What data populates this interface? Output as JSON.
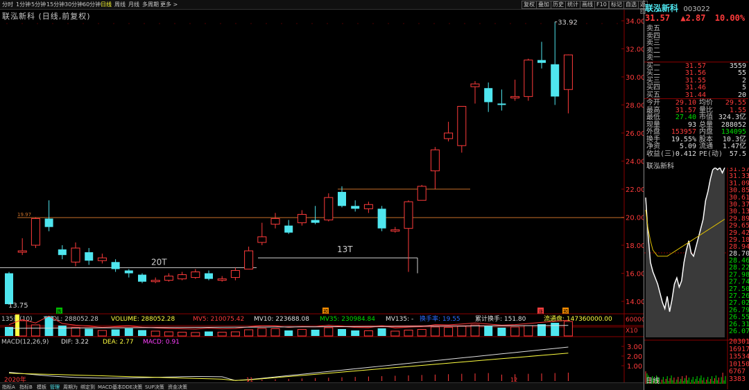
{
  "toolbar": {
    "timeframes": [
      "分时",
      "1分钟",
      "5分钟",
      "15分钟",
      "30分钟",
      "60分钟",
      "日线",
      "周线",
      "月线",
      "多周期",
      "更多 >"
    ],
    "active_timeframe": "日线",
    "right_buttons": [
      "复权",
      "叠加",
      "历史",
      "统计",
      "画线",
      "F10",
      "标记",
      "自选",
      "返回"
    ]
  },
  "chart": {
    "title": "联泓新科 (日线,前复权)",
    "price_ticks": [
      "34.00",
      "32.00",
      "30.00",
      "28.00",
      "26.00",
      "24.00",
      "22.00",
      "20.00",
      "18.00",
      "16.00",
      "14.00"
    ],
    "high_label": "33.92",
    "low_label": "13.75",
    "level_label": "19.97",
    "annotation_20t": "20T",
    "annotation_13t": "13T",
    "markers": [
      "跌",
      "预",
      "涨",
      "预"
    ],
    "volume_header": {
      "name": "135量(10)",
      "vvol": "VVOL: 288052.28",
      "volume": "VOLUME: 288052.28",
      "mv5": "MV5: 210075.42",
      "mv10": "MV10: 223688.08",
      "mv35": "MV35: 230984.84",
      "mv135": "MV135: -",
      "turnover": "换手率: 19.55",
      "cum_turnover": "累计换手: 151.80",
      "float": "流通盘: 147360000.00"
    },
    "volume_ticks": [
      "60000",
      "X10"
    ],
    "macd_header": {
      "name": "MACD(12,26,9)",
      "dif": "DIF: 3.22",
      "dea": "DEA: 2.77",
      "macd": "MACD: 0.91"
    },
    "macd_ticks": [
      "3.00",
      "2.00",
      "1.00"
    ],
    "year_label": "2020年",
    "month_labels": [
      "11",
      "12"
    ]
  },
  "candles": [
    {
      "o": 16.0,
      "c": 13.8,
      "h": 16.1,
      "l": 13.75
    },
    {
      "o": 17.5,
      "c": 17.6,
      "h": 18.5,
      "l": 17.3
    },
    {
      "o": 18.0,
      "c": 19.9,
      "h": 20.0,
      "l": 17.8
    },
    {
      "o": 19.9,
      "c": 19.3,
      "h": 21.2,
      "l": 19.0
    },
    {
      "o": 17.7,
      "c": 17.3,
      "h": 18.0,
      "l": 17.0
    },
    {
      "o": 16.8,
      "c": 17.8,
      "h": 18.2,
      "l": 16.5
    },
    {
      "o": 17.5,
      "c": 16.9,
      "h": 17.8,
      "l": 16.6
    },
    {
      "o": 16.9,
      "c": 17.1,
      "h": 17.4,
      "l": 16.7
    },
    {
      "o": 16.8,
      "c": 16.3,
      "h": 17.0,
      "l": 16.1
    },
    {
      "o": 16.2,
      "c": 16.0,
      "h": 16.3,
      "l": 15.7
    },
    {
      "o": 15.9,
      "c": 15.4,
      "h": 16.0,
      "l": 15.3
    },
    {
      "o": 15.4,
      "c": 15.5,
      "h": 15.7,
      "l": 15.3
    },
    {
      "o": 15.5,
      "c": 15.8,
      "h": 16.0,
      "l": 15.4
    },
    {
      "o": 15.6,
      "c": 15.9,
      "h": 16.1,
      "l": 15.5
    },
    {
      "o": 15.7,
      "c": 16.1,
      "h": 16.3,
      "l": 15.6
    },
    {
      "o": 16.0,
      "c": 15.6,
      "h": 16.2,
      "l": 15.5
    },
    {
      "o": 15.5,
      "c": 15.6,
      "h": 15.8,
      "l": 15.4
    },
    {
      "o": 15.7,
      "c": 16.2,
      "h": 16.4,
      "l": 15.5
    },
    {
      "o": 16.3,
      "c": 17.6,
      "h": 17.9,
      "l": 16.3
    },
    {
      "o": 18.2,
      "c": 18.6,
      "h": 19.6,
      "l": 18.0
    },
    {
      "o": 19.5,
      "c": 19.9,
      "h": 20.3,
      "l": 19.2
    },
    {
      "o": 19.4,
      "c": 18.9,
      "h": 19.8,
      "l": 18.8
    },
    {
      "o": 19.6,
      "c": 20.2,
      "h": 20.5,
      "l": 19.4
    },
    {
      "o": 19.8,
      "c": 19.6,
      "h": 20.8,
      "l": 19.5
    },
    {
      "o": 19.8,
      "c": 21.4,
      "h": 21.7,
      "l": 19.7
    },
    {
      "o": 21.8,
      "c": 20.8,
      "h": 22.2,
      "l": 20.7
    },
    {
      "o": 20.8,
      "c": 20.6,
      "h": 21.2,
      "l": 20.4
    },
    {
      "o": 20.6,
      "c": 20.9,
      "h": 21.1,
      "l": 20.3
    },
    {
      "o": 20.6,
      "c": 19.2,
      "h": 20.8,
      "l": 19.0
    },
    {
      "o": 19.0,
      "c": 19.1,
      "h": 19.3,
      "l": 18.9
    },
    {
      "o": 19.2,
      "c": 21.1,
      "h": 21.2,
      "l": 16.1
    },
    {
      "o": 21.2,
      "c": 22.2,
      "h": 22.3,
      "l": 21.2
    },
    {
      "o": 23.3,
      "c": 24.8,
      "h": 25.0,
      "l": 22.0
    },
    {
      "o": 25.6,
      "c": 26.0,
      "h": 26.8,
      "l": 25.4
    },
    {
      "o": 25.1,
      "c": 27.9,
      "h": 27.9,
      "l": 24.6
    },
    {
      "o": 29.3,
      "c": 29.5,
      "h": 29.7,
      "l": 28.1
    },
    {
      "o": 29.2,
      "c": 28.2,
      "h": 29.6,
      "l": 27.5
    },
    {
      "o": 28.1,
      "c": 28.0,
      "h": 29.1,
      "l": 27.6
    },
    {
      "o": 28.5,
      "c": 28.6,
      "h": 29.8,
      "l": 28.3
    },
    {
      "o": 28.6,
      "c": 31.2,
      "h": 31.3,
      "l": 28.3
    },
    {
      "o": 31.2,
      "c": 31.0,
      "h": 32.5,
      "l": 30.6
    },
    {
      "o": 30.9,
      "c": 28.6,
      "h": 33.92,
      "l": 28.0
    },
    {
      "o": 29.1,
      "c": 31.57,
      "h": 31.6,
      "l": 27.4
    }
  ],
  "volumes": [
    130,
    220,
    160,
    285,
    150,
    120,
    105,
    80,
    95,
    110,
    85,
    70,
    60,
    55,
    50,
    65,
    55,
    60,
    90,
    110,
    105,
    80,
    95,
    90,
    120,
    100,
    80,
    75,
    110,
    70,
    85,
    95,
    130,
    125,
    140,
    160,
    140,
    120,
    130,
    150,
    170,
    190,
    210
  ],
  "right_panel": {
    "stock_name": "联泓新科",
    "stock_code": "003022",
    "price": "31.57",
    "change": "▲2.87",
    "change_pct": "10.00%",
    "asks": [
      {
        "label": "卖五",
        "price": "",
        "vol": ""
      },
      {
        "label": "卖四",
        "price": "",
        "vol": ""
      },
      {
        "label": "卖三",
        "price": "",
        "vol": ""
      },
      {
        "label": "卖二",
        "price": "",
        "vol": ""
      },
      {
        "label": "卖一",
        "price": "",
        "vol": ""
      }
    ],
    "bids": [
      {
        "label": "买一",
        "price": "31.57",
        "vol": "3559"
      },
      {
        "label": "买二",
        "price": "31.56",
        "vol": "55"
      },
      {
        "label": "买三",
        "price": "31.55",
        "vol": "2"
      },
      {
        "label": "买四",
        "price": "31.46",
        "vol": "5"
      },
      {
        "label": "买五",
        "price": "31.44",
        "vol": "20"
      }
    ],
    "stats": [
      {
        "k1": "今开",
        "v1": "29.10",
        "k2": "均价",
        "v2": "29.55",
        "c1": "red",
        "c2": "red"
      },
      {
        "k1": "最高",
        "v1": "31.57",
        "k2": "量比",
        "v2": "1.55",
        "c1": "red",
        "c2": "red"
      },
      {
        "k1": "最低",
        "v1": "27.40",
        "k2": "市值",
        "v2": "324.3亿",
        "c1": "green",
        "c2": "white"
      },
      {
        "k1": "现量",
        "v1": "93",
        "k2": "总量",
        "v2": "288052",
        "c1": "white",
        "c2": "white"
      },
      {
        "k1": "外盘",
        "v1": "153957",
        "k2": "内盘",
        "v2": "134095",
        "c1": "red",
        "c2": "green"
      },
      {
        "k1": "换手",
        "v1": "19.55%",
        "k2": "股本",
        "v2": "10.3亿",
        "c1": "white",
        "c2": "white"
      },
      {
        "k1": "净资",
        "v1": "5.09",
        "k2": "流通",
        "v2": "1.47亿",
        "c1": "white",
        "c2": "white"
      },
      {
        "k1": "收益(三)",
        "v1": "0.412",
        "k2": "PE(动)",
        "v2": "57.5",
        "c1": "white",
        "c2": "white"
      }
    ],
    "mini_title": "联泓新科",
    "mini_ticks_red": [
      "31.57",
      "31.33",
      "31.09",
      "30.85",
      "30.61",
      "30.37",
      "30.13",
      "29.89",
      "29.65",
      "29.42",
      "29.18",
      "28.94"
    ],
    "mini_ticks_mid": "28.70",
    "mini_ticks_green": [
      "28.46",
      "28.22",
      "27.98",
      "27.74",
      "27.50",
      "27.26",
      "27.02",
      "26.79",
      "26.55",
      "26.31",
      "26.07"
    ],
    "mini_vol_ticks": [
      "20301",
      "16917",
      "13534",
      "10150",
      "6767",
      "3383"
    ],
    "mini_footer": "日线"
  },
  "bottom_tabs": [
    "指标A",
    "指标B",
    "模板",
    "管理",
    "周期为",
    "绑定到",
    "MACD基本",
    "DDE决策",
    "SUP决策",
    "资金决策"
  ],
  "active_bottom_tab": "管理"
}
